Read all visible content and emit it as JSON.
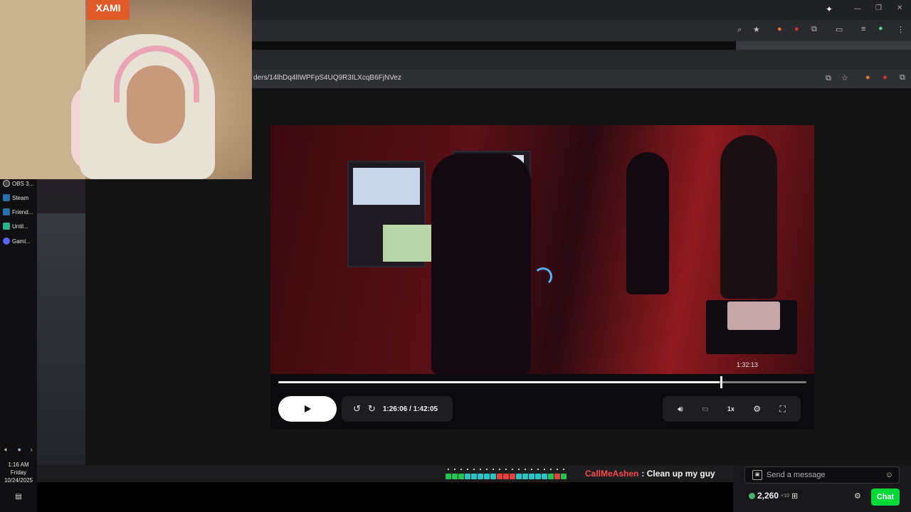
{
  "browser": {
    "url": "ders/14lhDq4lIWPFpS4UQ9R3ILXcqB6FjNVez"
  },
  "taskbar": {
    "items": [
      {
        "label": "OBS 3...",
        "icon": "obs-icon",
        "color": "#444"
      },
      {
        "label": "Steam",
        "icon": "steam-icon",
        "color": "#2a6fb0"
      },
      {
        "label": "Friend...",
        "icon": "steam-friends-icon",
        "color": "#2a6fb0"
      },
      {
        "label": "Until...",
        "icon": "app-icon",
        "color": "#2bb48a"
      },
      {
        "label": "Gami...",
        "icon": "discord-icon",
        "color": "#5865f2"
      }
    ],
    "clock": {
      "time": "1:16 AM",
      "day": "Friday",
      "date": "10/24/2025"
    }
  },
  "webcam": {
    "poster_text": "XAMI"
  },
  "player": {
    "current_time": "1:26:06 / 1:42:05",
    "preview_time": "1:32:13",
    "progress": 0.835,
    "speed_label": "1x",
    "accent": "#5ab0ff"
  },
  "stream_overlay": {
    "chat_user": "CallMeAshen",
    "chat_message": ": Clean up my guy",
    "emote_colors": [
      "#23c552",
      "#23c552",
      "#23c552",
      "#2bc5c5",
      "#2bc5c5",
      "#2bc5c5",
      "#2bc5c5",
      "#2bc5c5",
      "#e8413c",
      "#e8413c",
      "#e8413c",
      "#2bc5c5",
      "#2bc5c5",
      "#2bc5c5",
      "#2bc5c5",
      "#2bc5c5",
      "#23c552",
      "#e8413c",
      "#23c552"
    ]
  },
  "chat": {
    "placeholder": "Send a message",
    "points": "2,260",
    "points_delta": "+10",
    "chat_button": "Chat",
    "accent": "#00d93a"
  }
}
